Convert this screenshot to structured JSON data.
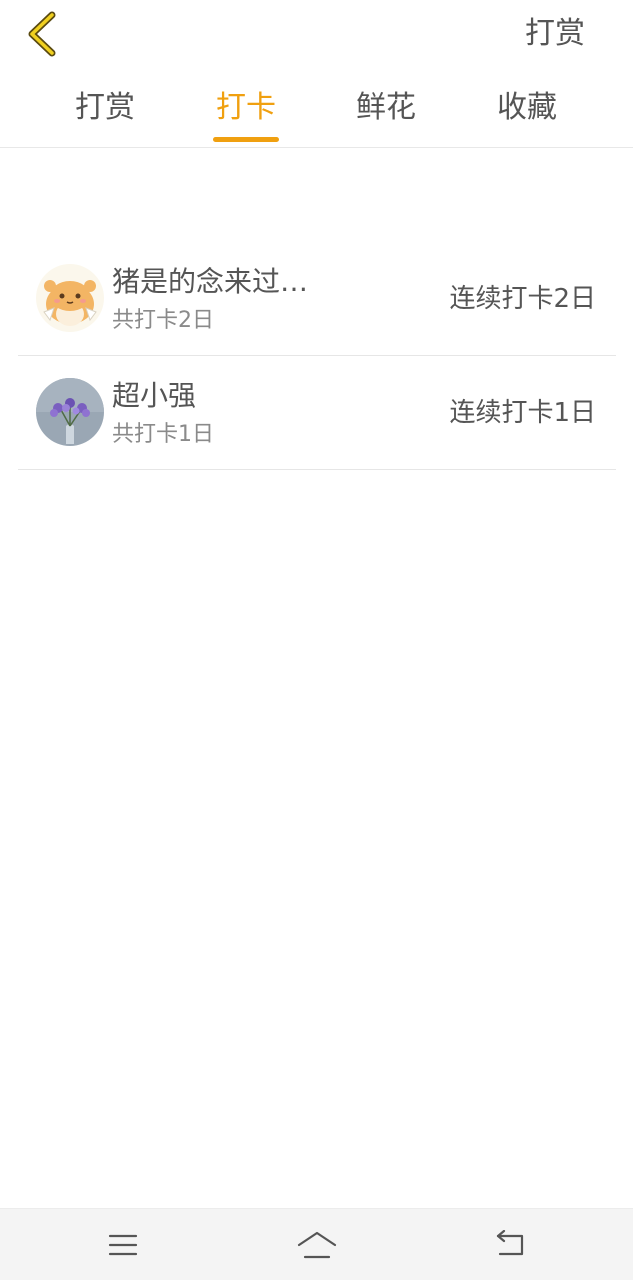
{
  "header": {
    "back_icon": "chevron-left-icon",
    "action_label": "打赏"
  },
  "tabs": [
    {
      "label": "打赏",
      "active": false
    },
    {
      "label": "打卡",
      "active": true
    },
    {
      "label": "鲜花",
      "active": false
    },
    {
      "label": "收藏",
      "active": false
    }
  ],
  "colors": {
    "accent": "#f0a010",
    "text": "#555555",
    "subtext": "#8a8a8a",
    "divider": "#e6e6e6",
    "navbar_bg": "#f4f4f4"
  },
  "list": [
    {
      "name": "猪是的念来过…",
      "total": "共打卡2日",
      "streak": "连续打卡2日",
      "avatar": "hamster-avatar"
    },
    {
      "name": "超小强",
      "total": "共打卡1日",
      "streak": "连续打卡1日",
      "avatar": "flower-avatar"
    }
  ],
  "navbar": {
    "menu_icon": "menu-icon",
    "home_icon": "home-icon",
    "back_icon": "back-arrow-icon"
  }
}
